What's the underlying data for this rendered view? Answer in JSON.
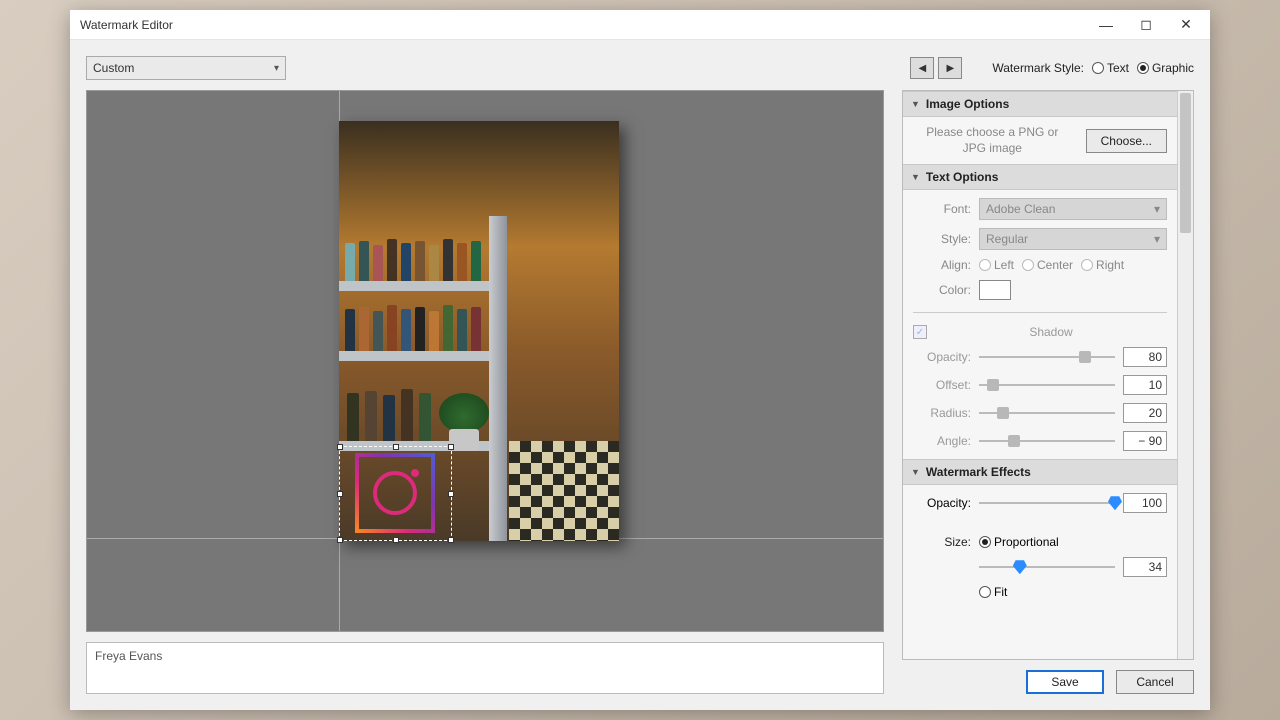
{
  "window": {
    "title": "Watermark Editor"
  },
  "preset": {
    "value": "Custom"
  },
  "watermark_style": {
    "label": "Watermark Style:",
    "text": "Text",
    "graphic": "Graphic",
    "selected": "Graphic"
  },
  "image_options": {
    "heading": "Image Options",
    "hint": "Please choose a PNG or JPG image",
    "choose_label": "Choose..."
  },
  "text_options": {
    "heading": "Text Options",
    "font_label": "Font:",
    "font_value": "Adobe Clean",
    "style_label": "Style:",
    "style_value": "Regular",
    "align_label": "Align:",
    "align_left": "Left",
    "align_center": "Center",
    "align_right": "Right",
    "color_label": "Color:",
    "shadow_label": "Shadow",
    "opacity_label": "Opacity:",
    "opacity_value": "80",
    "offset_label": "Offset:",
    "offset_value": "10",
    "radius_label": "Radius:",
    "radius_value": "20",
    "angle_label": "Angle:",
    "angle_value": "− 90"
  },
  "watermark_effects": {
    "heading": "Watermark Effects",
    "opacity_label": "Opacity:",
    "opacity_value": "100",
    "size_label": "Size:",
    "proportional": "Proportional",
    "proportional_value": "34",
    "fit": "Fit"
  },
  "text_input": {
    "value": "Freya Evans"
  },
  "footer": {
    "save": "Save",
    "cancel": "Cancel"
  }
}
